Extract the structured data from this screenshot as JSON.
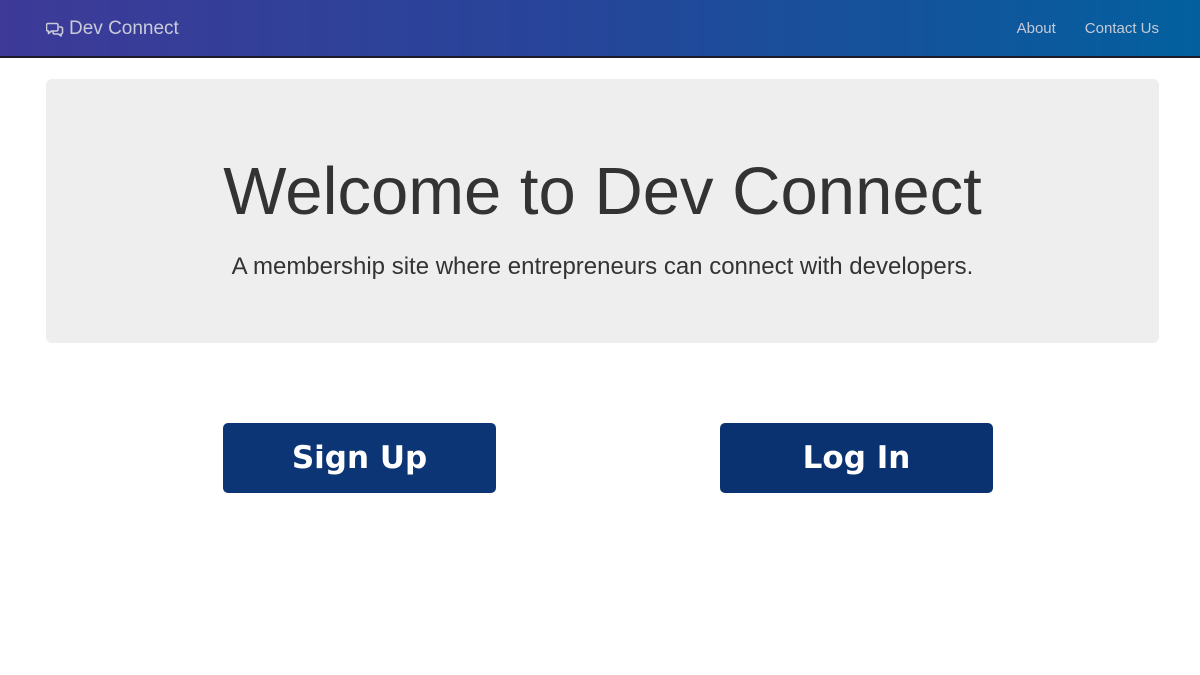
{
  "navbar": {
    "brand": {
      "icon": "chat-bubbles-icon",
      "label": "Dev Connect"
    },
    "links": [
      {
        "label": "About"
      },
      {
        "label": "Contact Us"
      }
    ]
  },
  "hero": {
    "title": "Welcome to Dev Connect",
    "subtitle": "A membership site where entrepreneurs can connect with developers."
  },
  "actions": {
    "signup_label": "Sign Up",
    "login_label": "Log In"
  },
  "colors": {
    "navbar_gradient_start": "#3d3a98",
    "navbar_gradient_end": "#03609e",
    "jumbotron_bg": "#eeeeee",
    "button_bg": "#0b3574",
    "button_text": "#ffffff"
  }
}
